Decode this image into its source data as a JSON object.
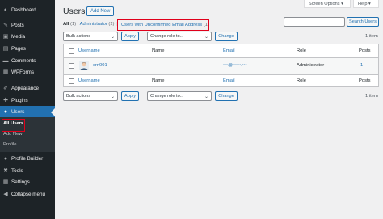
{
  "sidebar": {
    "items": [
      {
        "icon": "dashboard-icon",
        "glyph": "◐",
        "label": "Dashboard"
      },
      {
        "icon": "posts-icon",
        "glyph": "✎",
        "label": "Posts"
      },
      {
        "icon": "media-icon",
        "glyph": "▣",
        "label": "Media"
      },
      {
        "icon": "pages-icon",
        "glyph": "▤",
        "label": "Pages"
      },
      {
        "icon": "comments-icon",
        "glyph": "▬",
        "label": "Comments"
      },
      {
        "icon": "wpforms-icon",
        "glyph": "▦",
        "label": "WPForms"
      },
      {
        "icon": "appearance-icon",
        "glyph": "✐",
        "label": "Appearance"
      },
      {
        "icon": "plugins-icon",
        "glyph": "✚",
        "label": "Plugins"
      },
      {
        "icon": "users-icon",
        "glyph": "●",
        "label": "Users"
      },
      {
        "icon": "profile-builder-icon",
        "glyph": "●",
        "label": "Profile Builder"
      },
      {
        "icon": "tools-icon",
        "glyph": "✖",
        "label": "Tools"
      },
      {
        "icon": "settings-icon",
        "glyph": "▦",
        "label": "Settings"
      },
      {
        "icon": "collapse-icon",
        "glyph": "◀",
        "label": "Collapse menu"
      }
    ],
    "submenu": [
      "All Users",
      "Add New",
      "Profile"
    ]
  },
  "top_tabs": {
    "screen_options": "Screen Options ▾",
    "help": "Help ▾"
  },
  "header": {
    "title": "Users",
    "add_new": "Add New"
  },
  "filters": {
    "all": "All",
    "all_count": "(1)",
    "sep": "|",
    "administrator": "Administrator",
    "administrator_count": "(1)",
    "unconfirmed": "Users with Unconfirmed Email Address",
    "unconfirmed_count": "(1)"
  },
  "search": {
    "button": "Search Users",
    "value": ""
  },
  "bulk": {
    "selected": "Bulk actions",
    "apply": "Apply"
  },
  "role": {
    "selected": "Change role to...",
    "change": "Change"
  },
  "item_count": "1 item",
  "table": {
    "headers": [
      "Username",
      "Name",
      "Email",
      "Role",
      "Posts"
    ],
    "rows": [
      {
        "username": "crn001",
        "name": "—",
        "email": "•••@•••••.•••",
        "role": "Administrator",
        "posts": "1"
      }
    ]
  },
  "colors": {
    "accent": "#2271b1",
    "sidebar": "#1d2327",
    "highlight": "#e0001b"
  }
}
